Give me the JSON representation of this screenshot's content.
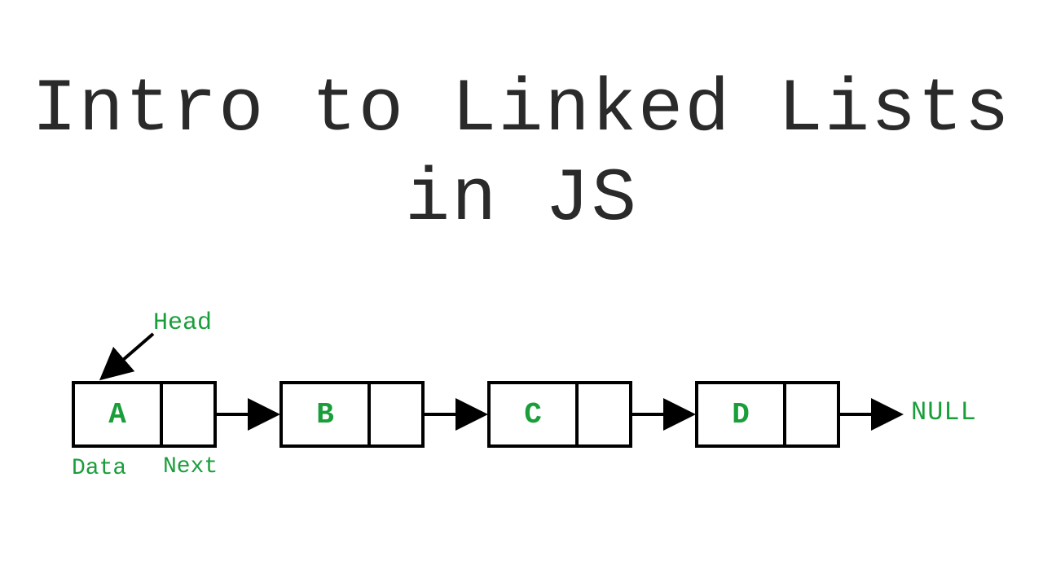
{
  "title": "Intro to Linked Lists in JS",
  "labels": {
    "head": "Head",
    "data": "Data",
    "next": "Next",
    "null": "NULL"
  },
  "nodes": [
    {
      "value": "A"
    },
    {
      "value": "B"
    },
    {
      "value": "C"
    },
    {
      "value": "D"
    }
  ]
}
